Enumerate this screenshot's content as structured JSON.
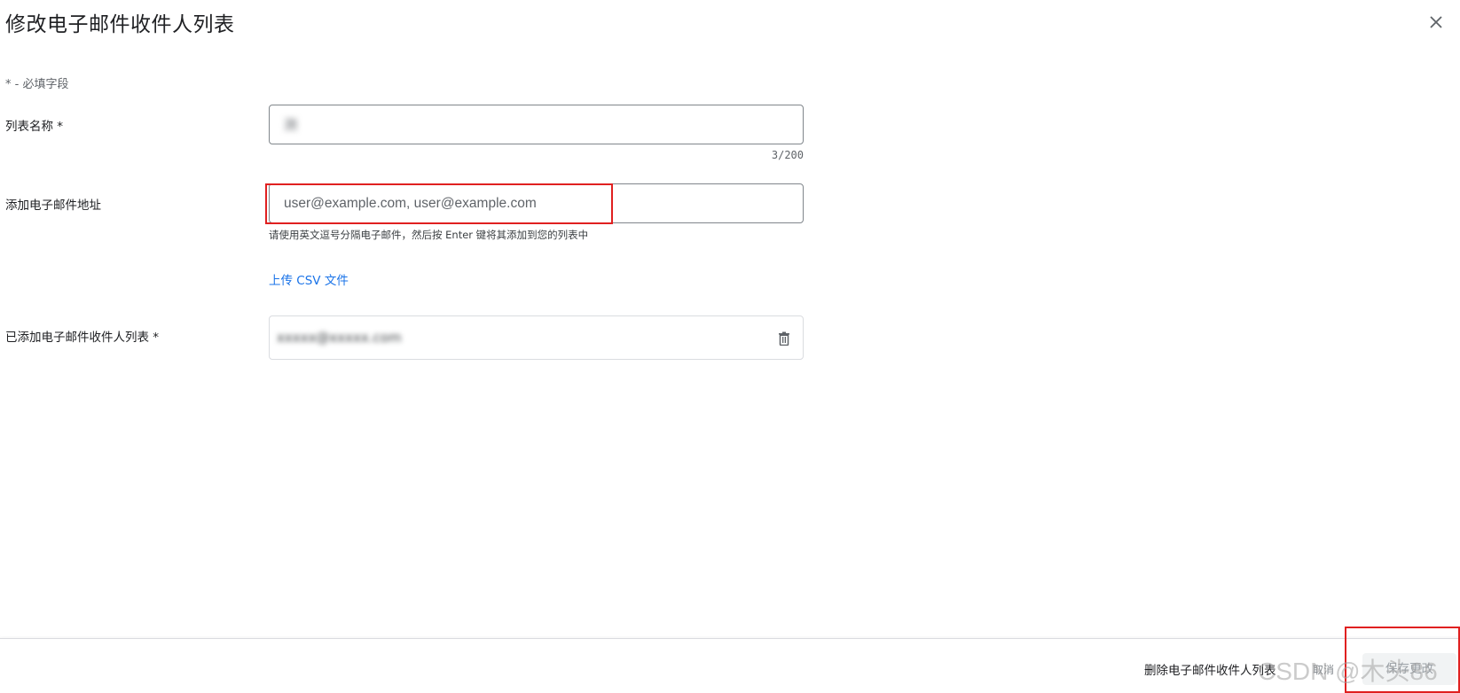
{
  "dialog": {
    "title": "修改电子邮件收件人列表",
    "required_note": "* - 必填字段"
  },
  "list_name": {
    "label": "列表名称 *",
    "value": "测",
    "counter": "3/200"
  },
  "add_email": {
    "label": "添加电子邮件地址",
    "placeholder": "user@example.com, user@example.com",
    "helper": "请使用英文逗号分隔电子邮件，然后按 Enter 键将其添加到您的列表中",
    "upload_link": "上传 CSV 文件"
  },
  "added_list": {
    "label": "已添加电子邮件收件人列表 *",
    "recipients": [
      "xxxxx@xxxxx.com"
    ]
  },
  "footer": {
    "delete_label": "删除电子邮件收件人列表",
    "cancel_label": "取消",
    "save_label": "保存更改"
  },
  "watermark": "CSDN @木头86",
  "icons": {
    "close": "close-icon",
    "delete": "trash-icon"
  },
  "colors": {
    "link": "#1a73e8",
    "highlight": "#e02020"
  }
}
